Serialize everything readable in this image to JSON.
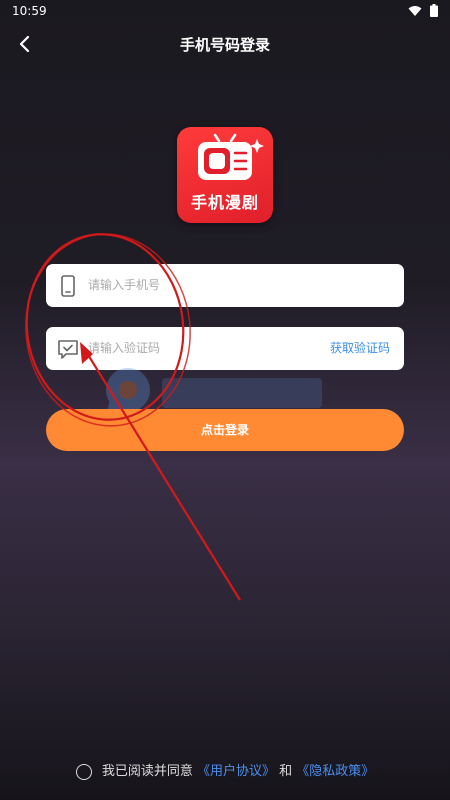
{
  "status": {
    "time": "10:59"
  },
  "nav": {
    "title": "手机号码登录"
  },
  "logo": {
    "text": "手机漫剧"
  },
  "phone": {
    "placeholder": "请输入手机号"
  },
  "code": {
    "placeholder": "请输入验证码",
    "get_code": "获取验证码"
  },
  "login": {
    "label": "点击登录"
  },
  "agreement": {
    "prefix": "我已阅读并同意",
    "user_agreement": "《用户协议》",
    "and": "和",
    "privacy_policy": "《隐私政策》"
  },
  "colors": {
    "accent": "#ff8a33",
    "link": "#4c8ff0",
    "logo_bg": "#e01f2a"
  }
}
